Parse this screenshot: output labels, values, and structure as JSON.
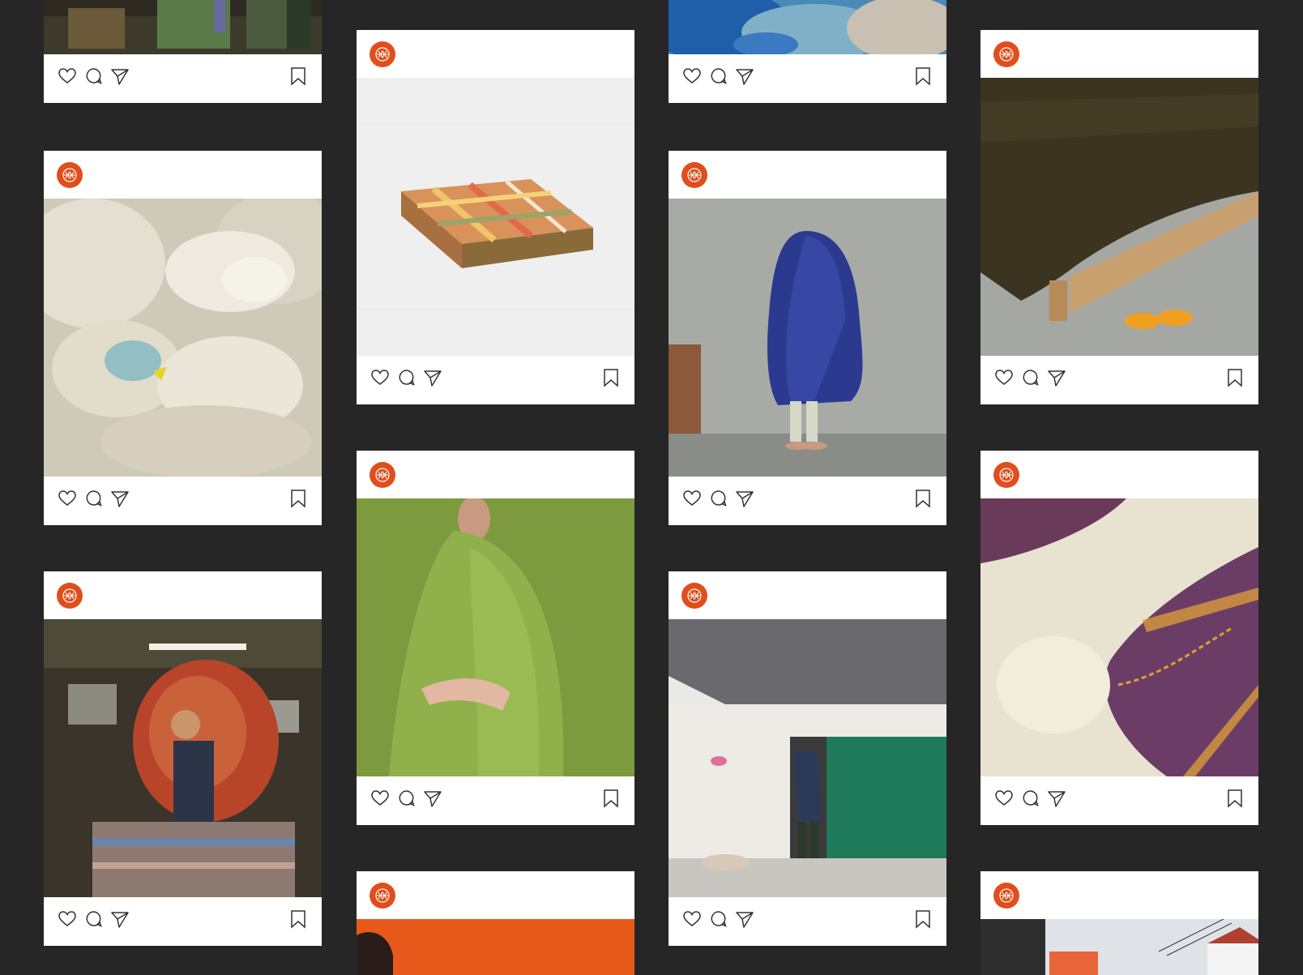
{
  "page": {
    "background": "#262626",
    "card_background": "#ffffff",
    "brand_color": "#e04e1b"
  },
  "icons": {
    "avatar": "mill-logo-icon",
    "like": "heart-icon",
    "comment": "comment-bubble-icon",
    "share": "paper-plane-icon",
    "save": "bookmark-icon"
  },
  "columns": [
    {
      "posts": [
        {
          "photo": "weaving-machinery",
          "header": false
        },
        {
          "photo": "sheep-with-lamb",
          "header": true
        },
        {
          "photo": "man-carrying-blankets-in-mill",
          "header": true
        }
      ]
    },
    {
      "posts": [
        {
          "photo": "folded-plaid-throw",
          "header": true
        },
        {
          "photo": "man-wrapped-in-green-blanket",
          "header": true
        },
        {
          "photo": "orange-background-portrait",
          "header": true
        }
      ]
    },
    {
      "posts": [
        {
          "photo": "blue-dyed-wool",
          "header": false
        },
        {
          "photo": "figure-under-blue-blanket",
          "header": true
        },
        {
          "photo": "man-entering-green-door-cottage",
          "header": true
        }
      ]
    },
    {
      "posts": [
        {
          "photo": "blanket-on-wooden-bed-with-orange-sandals",
          "header": true
        },
        {
          "photo": "cream-and-purple-blanket-closeup",
          "header": true
        },
        {
          "photo": "mill-building-exterior",
          "header": true
        }
      ]
    }
  ]
}
